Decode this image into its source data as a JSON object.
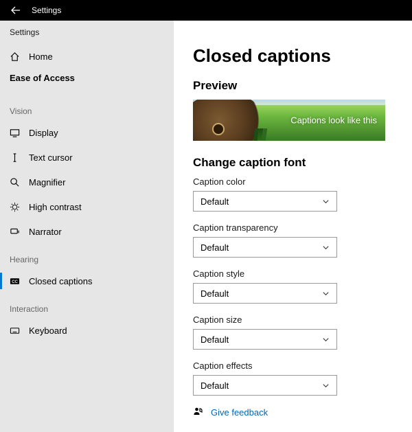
{
  "titlebar": {
    "title": "Settings"
  },
  "sidebar": {
    "app_label": "Settings",
    "home": "Home",
    "current_category": "Ease of Access",
    "groups": {
      "vision": "Vision",
      "hearing": "Hearing",
      "interaction": "Interaction"
    },
    "items": {
      "display": "Display",
      "text_cursor": "Text cursor",
      "magnifier": "Magnifier",
      "high_contrast": "High contrast",
      "narrator": "Narrator",
      "closed_captions": "Closed captions",
      "keyboard": "Keyboard"
    }
  },
  "main": {
    "heading": "Closed captions",
    "preview_heading": "Preview",
    "preview_caption": "Captions look like this",
    "font_heading": "Change caption font",
    "fields": {
      "caption_color": {
        "label": "Caption color",
        "value": "Default"
      },
      "caption_transparency": {
        "label": "Caption transparency",
        "value": "Default"
      },
      "caption_style": {
        "label": "Caption style",
        "value": "Default"
      },
      "caption_size": {
        "label": "Caption size",
        "value": "Default"
      },
      "caption_effects": {
        "label": "Caption effects",
        "value": "Default"
      }
    },
    "feedback": "Give feedback"
  }
}
